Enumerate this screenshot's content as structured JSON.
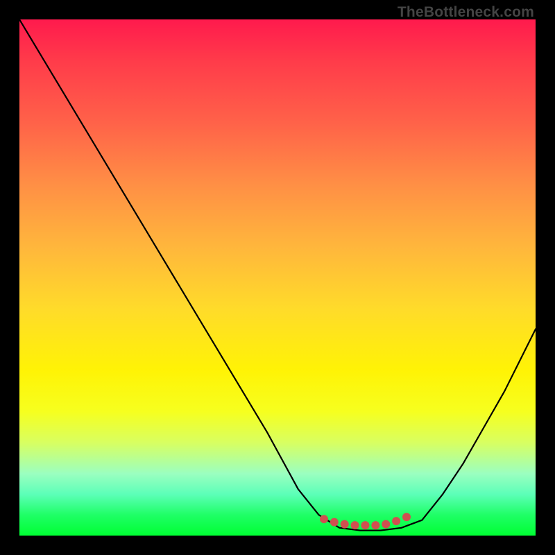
{
  "watermark": {
    "text": "TheBottleneck.com"
  },
  "chart_data": {
    "type": "line",
    "title": "",
    "xlabel": "",
    "ylabel": "",
    "xlim": [
      0,
      100
    ],
    "ylim": [
      0,
      100
    ],
    "background": "heat-gradient-red-to-green",
    "series": [
      {
        "name": "curve",
        "color": "#000000",
        "x": [
          0,
          6,
          12,
          18,
          24,
          30,
          36,
          42,
          48,
          54,
          58,
          62,
          66,
          70,
          74,
          78,
          82,
          86,
          90,
          94,
          98,
          100
        ],
        "values": [
          100,
          90,
          80,
          70,
          60,
          50,
          40,
          30,
          20,
          9,
          4,
          1.5,
          1,
          1,
          1.5,
          3,
          8,
          14,
          21,
          28,
          36,
          40
        ]
      },
      {
        "name": "dots",
        "color": "#d05050",
        "x": [
          59,
          61,
          63,
          65,
          67,
          69,
          71,
          73,
          75
        ],
        "values": [
          3.2,
          2.6,
          2.2,
          2.0,
          2.0,
          2.0,
          2.2,
          2.8,
          3.6
        ]
      }
    ],
    "annotations": []
  }
}
